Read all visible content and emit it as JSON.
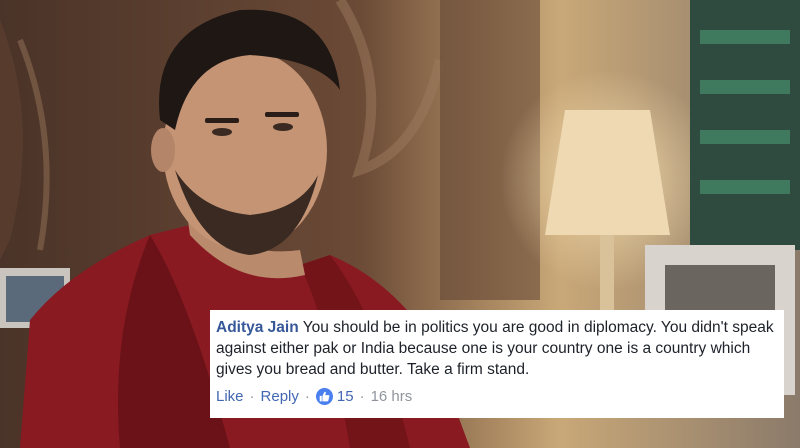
{
  "comment": {
    "author": "Aditya Jain",
    "text": "You should be in politics you are good in diplomacy. You didn't speak against either pak or India because one is your country one is a country which gives you bread and butter. Take a firm stand.",
    "like_label": "Like",
    "separator": "·",
    "reply_label": "Reply",
    "reaction_count": "15",
    "timestamp": "16 hrs"
  },
  "icons": {
    "reaction": "thumbs-up-icon"
  },
  "colors": {
    "author": "#365899",
    "link": "#4267b2",
    "reaction_badge": "#4a7ff0",
    "meta": "#90949c"
  }
}
